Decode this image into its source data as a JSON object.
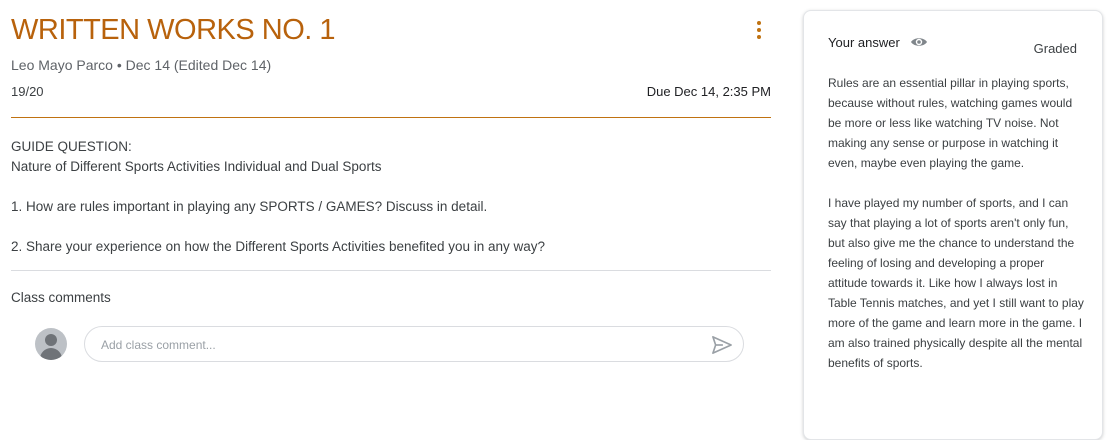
{
  "assignment": {
    "title": "WRITTEN WORKS NO. 1",
    "meta": "Leo Mayo Parco • Dec 14 (Edited Dec 14)",
    "points": "19/20",
    "due": "Due Dec 14, 2:35 PM"
  },
  "instructions": {
    "heading": "GUIDE QUESTION:",
    "topic": "Nature of Different Sports Activities Individual and Dual Sports",
    "question_1": "1. How are rules important in playing any SPORTS / GAMES? Discuss in detail.",
    "question_2": "2. Share your experience on how the Different Sports Activities benefited you in any way?"
  },
  "comments": {
    "label": "Class comments",
    "placeholder": "Add class comment..."
  },
  "your_work": {
    "label": "Your answer",
    "status": "Graded",
    "paragraph_1": "Rules are an essential pillar in playing sports, because without rules, watching games would be more or less like watching TV noise. Not making any sense or purpose in watching it even, maybe even playing the game.",
    "paragraph_2": "I have played my number of sports, and I can say that playing a lot of sports aren't only fun, but also give me the chance to understand the feeling of losing and developing a proper attitude towards it. Like how I always lost in Table Tennis matches, and yet I still want to play more of the game and learn more in the game. I am also trained physically despite all the mental benefits of sports."
  },
  "icons": {
    "more": "more-vert-icon",
    "send": "send-icon",
    "visibility": "eye-icon",
    "avatar": "default-avatar-icon"
  },
  "colors": {
    "accent": "#b8620c",
    "divider": "#dadce0"
  }
}
